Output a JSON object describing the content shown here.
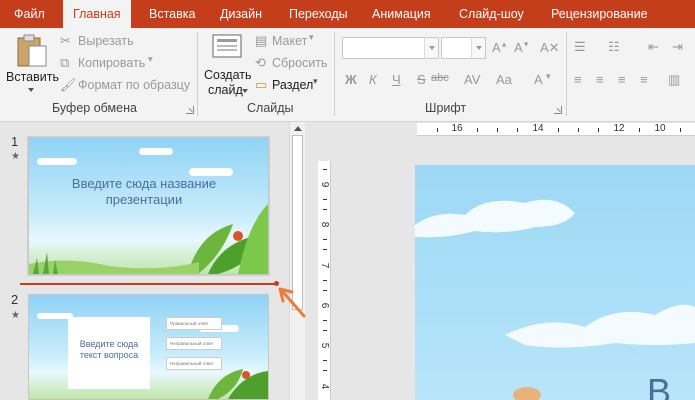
{
  "menu": {
    "tabs": [
      {
        "label": "Файл",
        "name": "tab-file"
      },
      {
        "label": "Главная",
        "name": "tab-home",
        "active": true
      },
      {
        "label": "Вставка",
        "name": "tab-insert"
      },
      {
        "label": "Дизайн",
        "name": "tab-design"
      },
      {
        "label": "Переходы",
        "name": "tab-transitions"
      },
      {
        "label": "Анимация",
        "name": "tab-animations"
      },
      {
        "label": "Слайд-шоу",
        "name": "tab-slideshow"
      },
      {
        "label": "Рецензирование",
        "name": "tab-review"
      }
    ],
    "accent_color": "#c43e1c"
  },
  "ribbon": {
    "clipboard": {
      "paste_label": "Вставить",
      "cut_label": "Вырезать",
      "copy_label": "Копировать",
      "format_painter_label": "Формат по образцу",
      "group_label": "Буфер обмена"
    },
    "slides": {
      "new_slide_label_1": "Создать",
      "new_slide_label_2": "слайд",
      "layout_label": "Макет",
      "reset_label": "Сбросить",
      "section_label": "Раздел",
      "group_label": "Слайды"
    },
    "font": {
      "bold": "Ж",
      "italic": "К",
      "underline": "Ч",
      "strike": "S",
      "spacing": "abc",
      "case": "Aa",
      "color": "A",
      "group_label": "Шрифт"
    }
  },
  "thumbnails": [
    {
      "number": "1",
      "star": "★",
      "title": "Введите сюда название презентации"
    },
    {
      "number": "2",
      "star": "★",
      "question": "Введите сюда текст вопроса",
      "answers": [
        "Правильный ответ",
        "Неправильный ответ",
        "Неправильный ответ"
      ]
    }
  ],
  "rulers": {
    "horizontal": [
      "16",
      "14",
      "12",
      "10"
    ],
    "vertical": [
      "9",
      "8",
      "7",
      "6",
      "5",
      "4"
    ]
  },
  "main_slide": {
    "visible_letter": "В"
  }
}
